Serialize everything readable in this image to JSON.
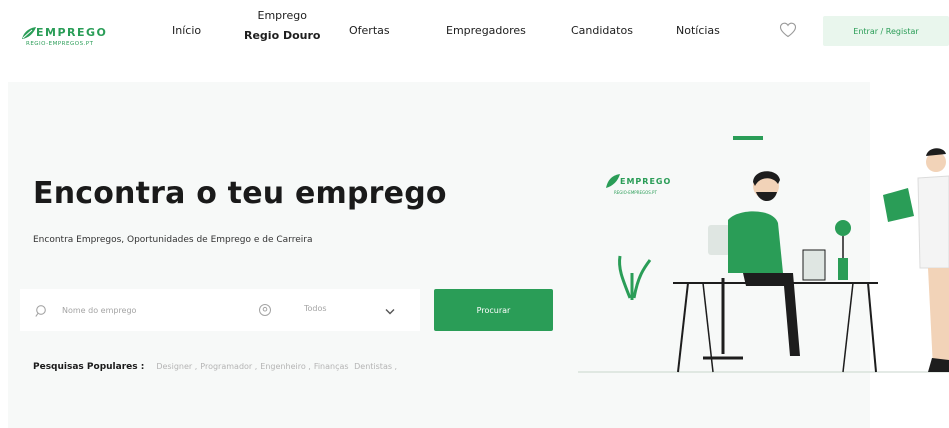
{
  "brand": {
    "name": "EMPREGO",
    "tagline": "REGIO-EMPREGOS.PT",
    "color": "#2a9d57"
  },
  "nav": {
    "inicio": "Início",
    "emprego_line1": "Emprego",
    "emprego_line2": "Regio Douro",
    "ofertas": "Ofertas",
    "empregadores": "Empregadores",
    "candidatos": "Candidatos",
    "noticias": "Notícias",
    "favorites_icon": "heart-icon",
    "login_label": "Entrar / Registar"
  },
  "hero": {
    "title": "Encontra o teu emprego",
    "subtitle": "Encontra Empregos, Oportunidades de Emprego e de Carreira",
    "background": "#f7f9f8"
  },
  "search": {
    "placeholder": "Nome do emprego",
    "search_icon": "search-icon",
    "location_icon": "location-icon",
    "location_value": "Todos",
    "chevron_icon": "chevron-down-icon",
    "button_label": "Procurar",
    "button_color": "#2a9d57"
  },
  "popular": {
    "label": "Pesquisas Populares :",
    "items": [
      "Designer",
      "Programador",
      "Engenheiro",
      "Finanças",
      "Dentistas"
    ]
  },
  "illustration": {
    "logo_text": "EMPREGO",
    "logo_sub": "REGIO-EMPREGOS.PT",
    "accent": "#2a9d57"
  }
}
